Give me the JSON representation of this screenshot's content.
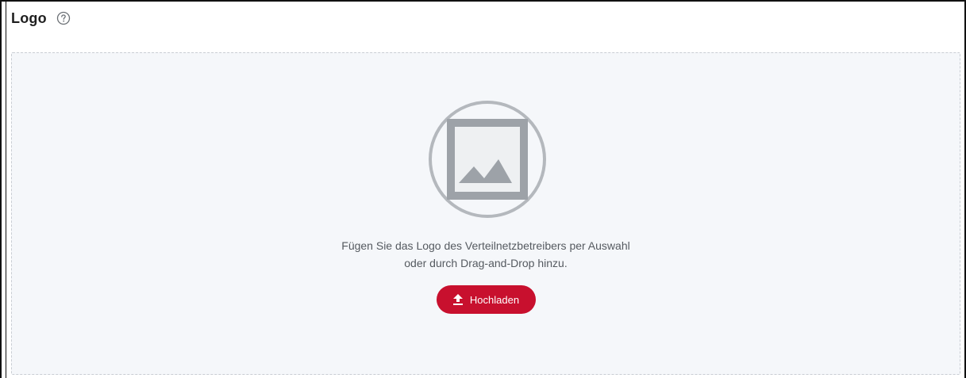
{
  "section": {
    "title": "Logo",
    "help_icon": "question-circle-icon"
  },
  "dropzone": {
    "placeholder_icon": "image-placeholder-icon",
    "hint_line1": "Fügen Sie das Logo des Verteilnetzbetreibers per Auswahl",
    "hint_line2": "oder durch Drag-and-Drop hinzu."
  },
  "upload": {
    "label": "Hochladen",
    "icon": "upload-icon"
  },
  "colors": {
    "accent": "#c8102e",
    "dropzone_bg": "#f5f7fa",
    "dropzone_border": "#c9cdd3",
    "icon_gray": "#9da2a8"
  }
}
